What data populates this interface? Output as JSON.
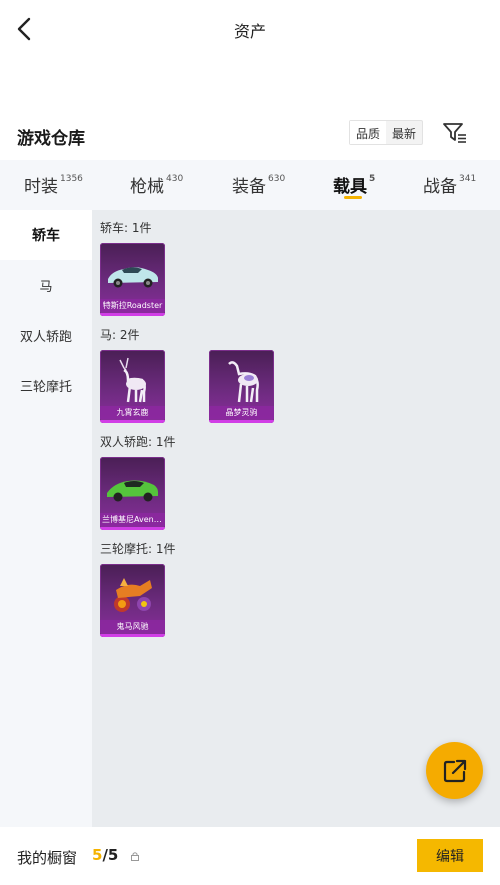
{
  "header": {
    "title": "资产",
    "back_icon": "chevron-left-icon"
  },
  "section": {
    "title": "游戏仓库",
    "sort_options": [
      "品质",
      "最新"
    ],
    "filter_icon": "filter-icon"
  },
  "tabs": [
    {
      "label": "时装",
      "count": "1356"
    },
    {
      "label": "枪械",
      "count": "430"
    },
    {
      "label": "装备",
      "count": "630"
    },
    {
      "label": "载具",
      "count": "5",
      "active": true
    },
    {
      "label": "战备",
      "count": "341"
    }
  ],
  "sidebar": [
    "轿车",
    "马",
    "双人轿跑",
    "三轮摩托"
  ],
  "groups": [
    {
      "label": "轿车: 1件",
      "items": [
        {
          "name": "特斯拉Roadster"
        }
      ]
    },
    {
      "label": "马: 2件",
      "items": [
        {
          "name": "九霄玄鹿"
        },
        {
          "name": "晶梦灵驹"
        }
      ]
    },
    {
      "label": "双人轿跑: 1件",
      "items": [
        {
          "name": "兰博基尼Aventador"
        }
      ]
    },
    {
      "label": "三轮摩托: 1件",
      "items": [
        {
          "name": "鬼马风驰"
        }
      ]
    }
  ],
  "fab_icon": "share-external-icon",
  "bottom": {
    "showcase_label": "我的橱窗",
    "showcase_current": "5",
    "showcase_total": "/5",
    "edit_label": "编辑"
  },
  "colors": {
    "accent": "#f5b300",
    "rarity_purple": "#8a2d9c"
  }
}
